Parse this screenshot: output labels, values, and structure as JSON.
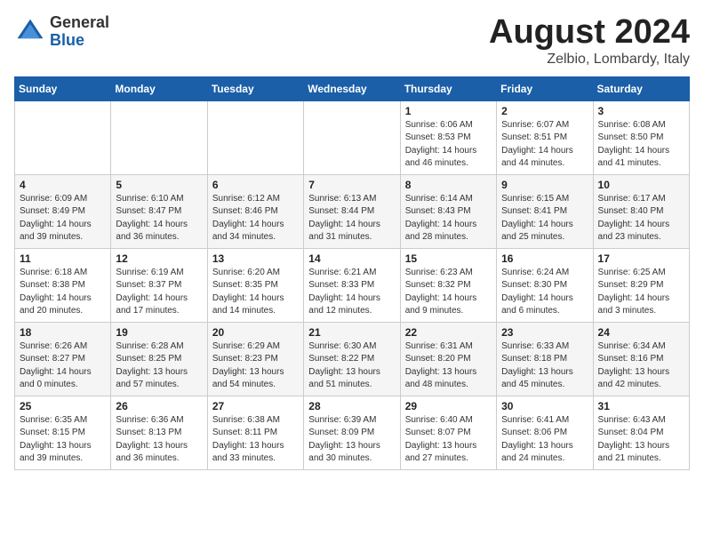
{
  "logo": {
    "general": "General",
    "blue": "Blue"
  },
  "title": "August 2024",
  "location": "Zelbio, Lombardy, Italy",
  "weekdays": [
    "Sunday",
    "Monday",
    "Tuesday",
    "Wednesday",
    "Thursday",
    "Friday",
    "Saturday"
  ],
  "weeks": [
    [
      {
        "num": "",
        "info": ""
      },
      {
        "num": "",
        "info": ""
      },
      {
        "num": "",
        "info": ""
      },
      {
        "num": "",
        "info": ""
      },
      {
        "num": "1",
        "info": "Sunrise: 6:06 AM\nSunset: 8:53 PM\nDaylight: 14 hours\nand 46 minutes."
      },
      {
        "num": "2",
        "info": "Sunrise: 6:07 AM\nSunset: 8:51 PM\nDaylight: 14 hours\nand 44 minutes."
      },
      {
        "num": "3",
        "info": "Sunrise: 6:08 AM\nSunset: 8:50 PM\nDaylight: 14 hours\nand 41 minutes."
      }
    ],
    [
      {
        "num": "4",
        "info": "Sunrise: 6:09 AM\nSunset: 8:49 PM\nDaylight: 14 hours\nand 39 minutes."
      },
      {
        "num": "5",
        "info": "Sunrise: 6:10 AM\nSunset: 8:47 PM\nDaylight: 14 hours\nand 36 minutes."
      },
      {
        "num": "6",
        "info": "Sunrise: 6:12 AM\nSunset: 8:46 PM\nDaylight: 14 hours\nand 34 minutes."
      },
      {
        "num": "7",
        "info": "Sunrise: 6:13 AM\nSunset: 8:44 PM\nDaylight: 14 hours\nand 31 minutes."
      },
      {
        "num": "8",
        "info": "Sunrise: 6:14 AM\nSunset: 8:43 PM\nDaylight: 14 hours\nand 28 minutes."
      },
      {
        "num": "9",
        "info": "Sunrise: 6:15 AM\nSunset: 8:41 PM\nDaylight: 14 hours\nand 25 minutes."
      },
      {
        "num": "10",
        "info": "Sunrise: 6:17 AM\nSunset: 8:40 PM\nDaylight: 14 hours\nand 23 minutes."
      }
    ],
    [
      {
        "num": "11",
        "info": "Sunrise: 6:18 AM\nSunset: 8:38 PM\nDaylight: 14 hours\nand 20 minutes."
      },
      {
        "num": "12",
        "info": "Sunrise: 6:19 AM\nSunset: 8:37 PM\nDaylight: 14 hours\nand 17 minutes."
      },
      {
        "num": "13",
        "info": "Sunrise: 6:20 AM\nSunset: 8:35 PM\nDaylight: 14 hours\nand 14 minutes."
      },
      {
        "num": "14",
        "info": "Sunrise: 6:21 AM\nSunset: 8:33 PM\nDaylight: 14 hours\nand 12 minutes."
      },
      {
        "num": "15",
        "info": "Sunrise: 6:23 AM\nSunset: 8:32 PM\nDaylight: 14 hours\nand 9 minutes."
      },
      {
        "num": "16",
        "info": "Sunrise: 6:24 AM\nSunset: 8:30 PM\nDaylight: 14 hours\nand 6 minutes."
      },
      {
        "num": "17",
        "info": "Sunrise: 6:25 AM\nSunset: 8:29 PM\nDaylight: 14 hours\nand 3 minutes."
      }
    ],
    [
      {
        "num": "18",
        "info": "Sunrise: 6:26 AM\nSunset: 8:27 PM\nDaylight: 14 hours\nand 0 minutes."
      },
      {
        "num": "19",
        "info": "Sunrise: 6:28 AM\nSunset: 8:25 PM\nDaylight: 13 hours\nand 57 minutes."
      },
      {
        "num": "20",
        "info": "Sunrise: 6:29 AM\nSunset: 8:23 PM\nDaylight: 13 hours\nand 54 minutes."
      },
      {
        "num": "21",
        "info": "Sunrise: 6:30 AM\nSunset: 8:22 PM\nDaylight: 13 hours\nand 51 minutes."
      },
      {
        "num": "22",
        "info": "Sunrise: 6:31 AM\nSunset: 8:20 PM\nDaylight: 13 hours\nand 48 minutes."
      },
      {
        "num": "23",
        "info": "Sunrise: 6:33 AM\nSunset: 8:18 PM\nDaylight: 13 hours\nand 45 minutes."
      },
      {
        "num": "24",
        "info": "Sunrise: 6:34 AM\nSunset: 8:16 PM\nDaylight: 13 hours\nand 42 minutes."
      }
    ],
    [
      {
        "num": "25",
        "info": "Sunrise: 6:35 AM\nSunset: 8:15 PM\nDaylight: 13 hours\nand 39 minutes."
      },
      {
        "num": "26",
        "info": "Sunrise: 6:36 AM\nSunset: 8:13 PM\nDaylight: 13 hours\nand 36 minutes."
      },
      {
        "num": "27",
        "info": "Sunrise: 6:38 AM\nSunset: 8:11 PM\nDaylight: 13 hours\nand 33 minutes."
      },
      {
        "num": "28",
        "info": "Sunrise: 6:39 AM\nSunset: 8:09 PM\nDaylight: 13 hours\nand 30 minutes."
      },
      {
        "num": "29",
        "info": "Sunrise: 6:40 AM\nSunset: 8:07 PM\nDaylight: 13 hours\nand 27 minutes."
      },
      {
        "num": "30",
        "info": "Sunrise: 6:41 AM\nSunset: 8:06 PM\nDaylight: 13 hours\nand 24 minutes."
      },
      {
        "num": "31",
        "info": "Sunrise: 6:43 AM\nSunset: 8:04 PM\nDaylight: 13 hours\nand 21 minutes."
      }
    ]
  ]
}
